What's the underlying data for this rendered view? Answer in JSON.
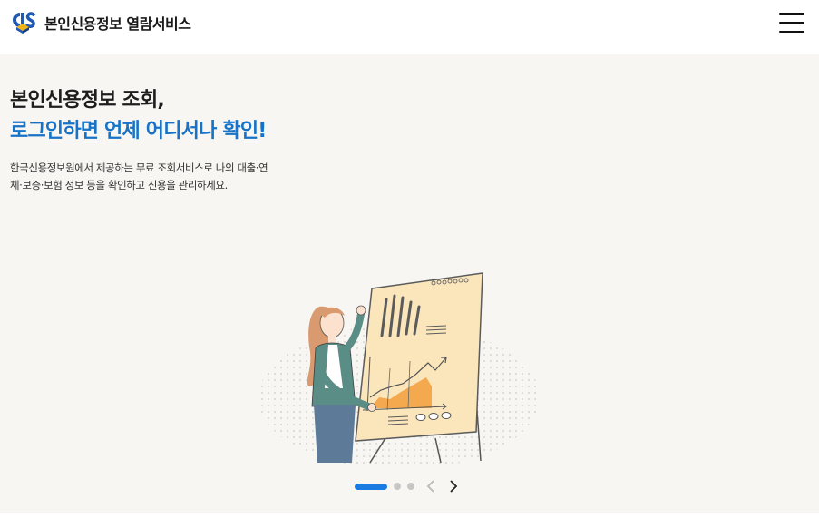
{
  "header": {
    "site_title": "본인신용정보 열람서비스",
    "logo_text": "CIS"
  },
  "hero": {
    "headline_line1": "본인신용정보 조회,",
    "headline_line2": "로그인하면 언제 어디서나 확인!",
    "description": "한국신용정보원에서 제공하는 무료 조회서비스로 나의 대출·연체·보증·보험 정보 등을 확인하고 신용을 관리하세요."
  },
  "carousel": {
    "total_slides": 3,
    "current_slide": 1
  },
  "colors": {
    "accent": "#1773c7",
    "pager_active": "#1a7be0",
    "hero_bg": "#f7f6f3"
  },
  "icons": {
    "menu": "hamburger-menu-icon",
    "prev": "chevron-left-icon",
    "next": "chevron-right-icon"
  }
}
